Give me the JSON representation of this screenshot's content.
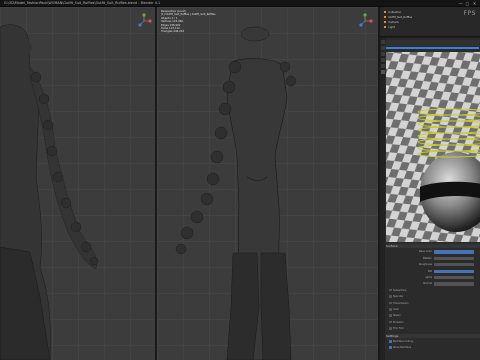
{
  "window": {
    "title": "G:\\3D\\Model_FashionPack\\WOMAN\\Outfit_Suit_Ruffles\\Outfit_Suit_Ruffles.blend - Blender 4.1",
    "controls": [
      "—",
      "□",
      "✕"
    ]
  },
  "viewport_left": {
    "stats": [],
    "gizmo_axes": [
      "X",
      "Y",
      "Z"
    ]
  },
  "viewport_right": {
    "stats": [
      "Perspective (Local)",
      "(1) Outfit_Suit_Ruffles | Outfit_Suit_Ruffles",
      "Objects  1 / 1",
      "Vertices  123,460",
      "Edges  246,502",
      "Faces  123,112",
      "Triangles  246,224"
    ],
    "gizmo_axes": [
      "X",
      "Y",
      "Z"
    ],
    "overlay": "FPS"
  },
  "outliner": {
    "rows": [
      "Collection",
      "Outfit_Suit_Ruffles",
      "Camera",
      "Light"
    ]
  },
  "properties": {
    "material_name": "Fabric_Material",
    "rows": [
      {
        "label": "Surface",
        "type": "section"
      },
      {
        "label": "Base Color",
        "type": "field",
        "color": "blue"
      },
      {
        "label": "Metallic",
        "type": "field"
      },
      {
        "label": "Roughness",
        "type": "field"
      },
      {
        "label": "IOR",
        "type": "field",
        "color": "blue"
      },
      {
        "label": "Alpha",
        "type": "field"
      },
      {
        "label": "Normal",
        "type": "field"
      },
      {
        "label": "Subsurface",
        "type": "check"
      },
      {
        "label": "Specular",
        "type": "check"
      },
      {
        "label": "Transmission",
        "type": "check"
      },
      {
        "label": "Coat",
        "type": "check"
      },
      {
        "label": "Sheen",
        "type": "check"
      },
      {
        "label": "Emission",
        "type": "check"
      },
      {
        "label": "Thin Film",
        "type": "check"
      },
      {
        "label": "Settings",
        "type": "section"
      },
      {
        "label": "Backface Culling",
        "type": "check",
        "on": true
      },
      {
        "label": "Show Backface",
        "type": "check",
        "on": true
      }
    ]
  }
}
